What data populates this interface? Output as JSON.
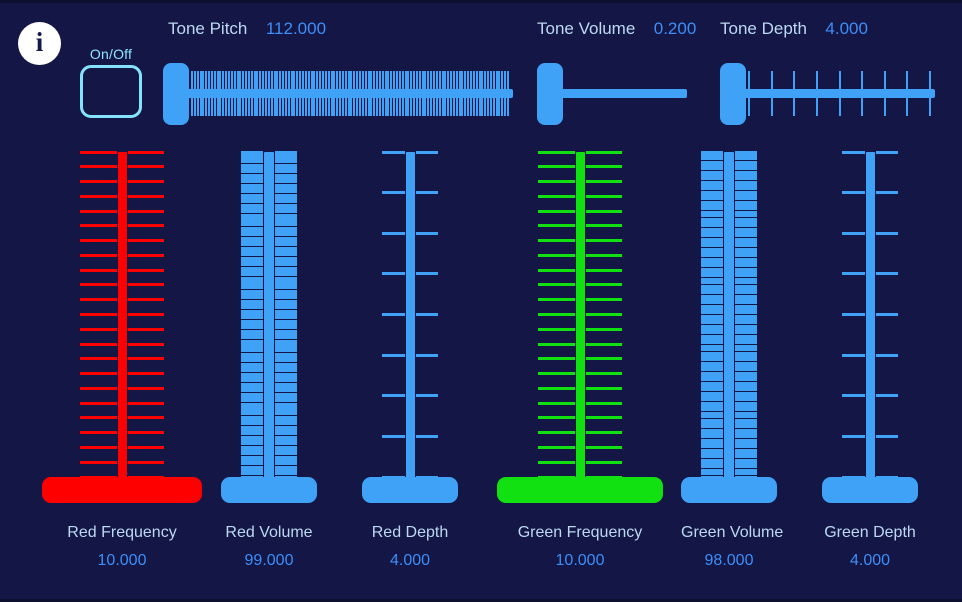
{
  "background_color": "#141645",
  "accent_blue": "#3fa2f7",
  "label_color": "#bcd9f2",
  "value_color": "#3d8ef8",
  "red_color": "#fe0000",
  "green_color": "#11e111",
  "info": {
    "icon": "info-icon",
    "glyph": "i"
  },
  "power": {
    "label": "On/Off",
    "state": "off"
  },
  "tone_controls": [
    {
      "id": "tone-pitch",
      "label": "Tone Pitch",
      "value": "112.000",
      "ticks": 112,
      "track_filled_fraction": 1.0
    },
    {
      "id": "tone-volume",
      "label": "Tone Volume",
      "value": "0.200",
      "ticks": 0,
      "track_filled_fraction": 1.0
    },
    {
      "id": "tone-depth",
      "label": "Tone Depth",
      "value": "4.000",
      "ticks": 9,
      "track_filled_fraction": 1.0
    }
  ],
  "channel_controls": [
    {
      "id": "red-frequency",
      "label": "Red Frequency",
      "value": "10.000",
      "color": "#fe0000",
      "ticks": 23,
      "tick_half_width": 42,
      "stem_width": 9,
      "thumb_width": 160,
      "thumb_height": 26
    },
    {
      "id": "red-volume",
      "label": "Red Volume",
      "value": "99.000",
      "color": "#3fa2f7",
      "ticks": 99,
      "tick_half_width": 28,
      "stem_width": 10,
      "thumb_width": 96,
      "thumb_height": 26
    },
    {
      "id": "red-depth",
      "label": "Red Depth",
      "value": "4.000",
      "color": "#3fa2f7",
      "ticks": 9,
      "tick_half_width": 28,
      "stem_width": 9,
      "thumb_width": 96,
      "thumb_height": 26
    },
    {
      "id": "green-frequency",
      "label": "Green Frequency",
      "value": "10.000",
      "color": "#11e111",
      "ticks": 23,
      "tick_half_width": 42,
      "stem_width": 9,
      "thumb_width": 166,
      "thumb_height": 26
    },
    {
      "id": "green-volume",
      "label": "Green Volume",
      "value": "98.000",
      "color": "#3fa2f7",
      "ticks": 98,
      "tick_half_width": 28,
      "stem_width": 10,
      "thumb_width": 96,
      "thumb_height": 26
    },
    {
      "id": "green-depth",
      "label": "Green Depth",
      "value": "4.000",
      "color": "#3fa2f7",
      "ticks": 9,
      "tick_half_width": 28,
      "stem_width": 9,
      "thumb_width": 96,
      "thumb_height": 26
    }
  ]
}
